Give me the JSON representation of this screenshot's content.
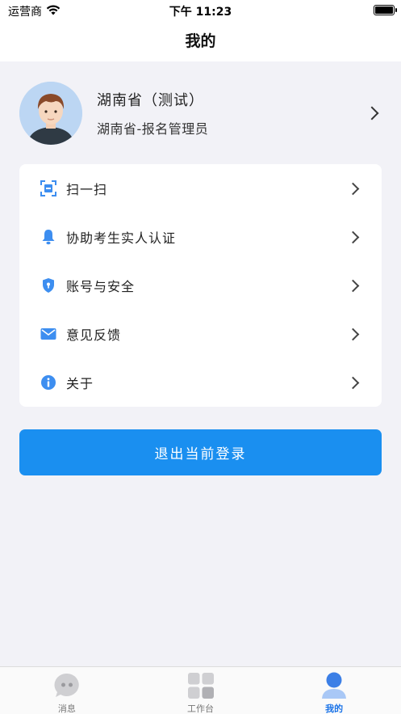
{
  "status_bar": {
    "carrier": "运营商",
    "time": "下午 11:23"
  },
  "header": {
    "title": "我的"
  },
  "profile": {
    "name": "湖南省（测试）",
    "role": "湖南省-报名管理员"
  },
  "menu": {
    "items": [
      {
        "label": "扫一扫",
        "icon": "scan-icon"
      },
      {
        "label": "协助考生实人认证",
        "icon": "bell-icon"
      },
      {
        "label": "账号与安全",
        "icon": "shield-icon"
      },
      {
        "label": "意见反馈",
        "icon": "mail-icon"
      },
      {
        "label": "关于",
        "icon": "info-icon"
      }
    ]
  },
  "logout": {
    "label": "退出当前登录"
  },
  "tabbar": {
    "tabs": [
      {
        "label": "消息",
        "icon": "chat-icon",
        "active": false
      },
      {
        "label": "工作台",
        "icon": "grid-icon",
        "active": false
      },
      {
        "label": "我的",
        "icon": "person-icon",
        "active": true
      }
    ]
  },
  "colors": {
    "accent": "#1a8ff0",
    "icon_blue": "#3d8ef0",
    "background": "#f2f2f7",
    "tab_active": "#1a73e8"
  }
}
